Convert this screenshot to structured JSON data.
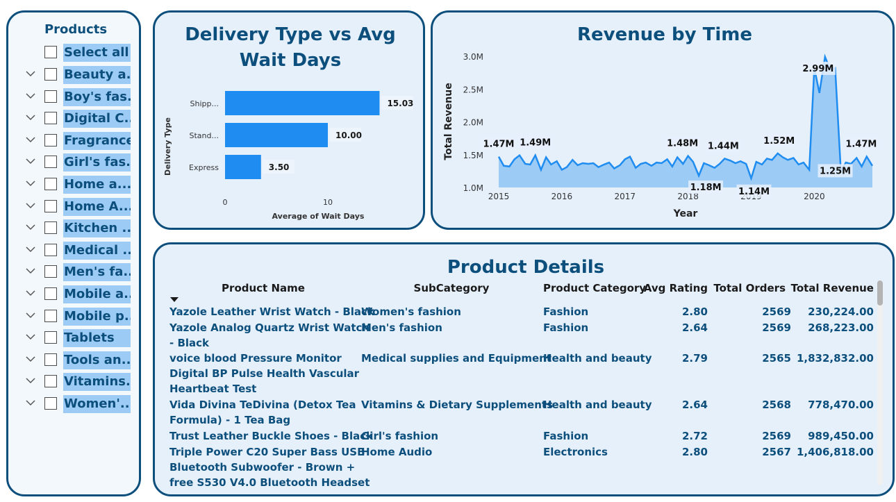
{
  "slicer": {
    "title": "Products",
    "select_all": "Select all",
    "items": [
      "Beauty a...",
      "Boy's fas...",
      "Digital C...",
      "Fragrances",
      "Girl's fas...",
      "Home a...",
      "Home A...",
      "Kitchen ...",
      "Medical ...",
      "Men's fa...",
      "Mobile a...",
      "Mobile p...",
      "Tablets",
      "Tools an...",
      "Vitamins...",
      "Women'..."
    ]
  },
  "bar_chart": {
    "title": "Delivery Type vs Avg Wait Days",
    "bar_color": "#1e8cf0"
  },
  "line_chart": {
    "title": "Revenue by Time",
    "line_color": "#1e8cf0",
    "area_color": "#9ccbf5"
  },
  "chart_data": [
    {
      "type": "bar",
      "orientation": "horizontal",
      "title": "Delivery Type vs Avg Wait Days",
      "xlabel": "Average of Wait Days",
      "ylabel": "Delivery Type",
      "categories": [
        "Shipp...",
        "Stand...",
        "Express"
      ],
      "values": [
        15.03,
        10.0,
        3.5
      ],
      "data_labels": [
        "15.03",
        "10.00",
        "3.50"
      ],
      "x_ticks": [
        "0",
        "10"
      ],
      "xlim": [
        0,
        20
      ]
    },
    {
      "type": "area",
      "title": "Revenue by Time",
      "xlabel": "Year",
      "ylabel": "Total Revenue",
      "x_ticks": [
        "2015",
        "2016",
        "2017",
        "2018",
        "2019",
        "2020"
      ],
      "y_ticks": [
        "1.0M",
        "1.5M",
        "2.0M",
        "2.5M",
        "3.0M"
      ],
      "ylim": [
        1.0,
        3.0
      ],
      "xlim": [
        2015.0,
        2020.92
      ],
      "x": [
        2015.0,
        2015.08,
        2015.17,
        2015.25,
        2015.33,
        2015.42,
        2015.5,
        2015.58,
        2015.67,
        2015.75,
        2015.83,
        2015.92,
        2016.0,
        2016.08,
        2016.17,
        2016.25,
        2016.33,
        2016.42,
        2016.5,
        2016.58,
        2016.67,
        2016.75,
        2016.83,
        2016.92,
        2017.0,
        2017.08,
        2017.17,
        2017.25,
        2017.33,
        2017.42,
        2017.5,
        2017.58,
        2017.67,
        2017.75,
        2017.83,
        2017.92,
        2018.0,
        2018.08,
        2018.17,
        2018.25,
        2018.33,
        2018.42,
        2018.5,
        2018.58,
        2018.67,
        2018.75,
        2018.83,
        2018.92,
        2019.0,
        2019.08,
        2019.17,
        2019.25,
        2019.33,
        2019.42,
        2019.5,
        2019.58,
        2019.67,
        2019.75,
        2019.83,
        2019.92,
        2020.0,
        2020.08,
        2020.17,
        2020.25,
        2020.33,
        2020.42,
        2020.5,
        2020.58,
        2020.67,
        2020.75,
        2020.83,
        2020.92
      ],
      "y": [
        1.47,
        1.33,
        1.32,
        1.43,
        1.49,
        1.36,
        1.35,
        1.49,
        1.27,
        1.46,
        1.35,
        1.4,
        1.27,
        1.31,
        1.42,
        1.34,
        1.37,
        1.36,
        1.37,
        1.31,
        1.35,
        1.38,
        1.29,
        1.34,
        1.43,
        1.47,
        1.3,
        1.36,
        1.38,
        1.33,
        1.38,
        1.37,
        1.43,
        1.32,
        1.46,
        1.36,
        1.48,
        1.39,
        1.18,
        1.37,
        1.34,
        1.3,
        1.36,
        1.44,
        1.41,
        1.37,
        1.4,
        1.36,
        1.14,
        1.39,
        1.35,
        1.44,
        1.42,
        1.52,
        1.46,
        1.42,
        1.45,
        1.35,
        1.38,
        1.27,
        2.82,
        2.44,
        2.99,
        2.8,
        2.82,
        1.25,
        1.38,
        1.36,
        1.45,
        1.32,
        1.47,
        1.33
      ],
      "data_labels": [
        {
          "x": 2015.0,
          "y": 1.47,
          "text": "1.47M"
        },
        {
          "x": 2015.58,
          "y": 1.49,
          "text": "1.49M"
        },
        {
          "x": 2018.0,
          "y": 1.48,
          "text": "1.48M"
        },
        {
          "x": 2018.17,
          "y": 1.18,
          "text": "1.18M"
        },
        {
          "x": 2018.58,
          "y": 1.44,
          "text": "1.44M"
        },
        {
          "x": 2019.0,
          "y": 1.14,
          "text": "1.14M"
        },
        {
          "x": 2019.42,
          "y": 1.52,
          "text": "1.52M"
        },
        {
          "x": 2020.17,
          "y": 2.99,
          "text": "2.99M"
        },
        {
          "x": 2020.42,
          "y": 1.25,
          "text": "1.25M"
        },
        {
          "x": 2020.83,
          "y": 1.47,
          "text": "1.47M"
        }
      ]
    }
  ],
  "table": {
    "title": "Product Details",
    "headers": [
      "Product Name",
      "SubCategory",
      "Product Category",
      "Avg Rating",
      "Total Orders",
      "Total Revenue"
    ],
    "rows": [
      {
        "name": [
          "Yazole Leather Wrist Watch - Black"
        ],
        "sub": "Women's fashion",
        "cat": "Fashion",
        "rating": "2.80",
        "orders": "2569",
        "revenue": "230,224.00"
      },
      {
        "name": [
          "Yazole Analog Quartz Wrist Watch",
          "- Black"
        ],
        "sub": "Men's fashion",
        "cat": "Fashion",
        "rating": "2.64",
        "orders": "2569",
        "revenue": "268,223.00"
      },
      {
        "name": [
          "voice blood Pressure Monitor",
          "Digital BP Pulse Health Vascular",
          "Heartbeat Test"
        ],
        "sub": "Medical supplies and Equipment",
        "cat": "Health and beauty",
        "rating": "2.79",
        "orders": "2565",
        "revenue": "1,832,832.00"
      },
      {
        "name": [
          "Vida Divina TeDivina (Detox Tea",
          "Formula) - 1 Tea Bag"
        ],
        "sub": "Vitamins & Dietary Supplements",
        "cat": "Health and beauty",
        "rating": "2.64",
        "orders": "2568",
        "revenue": "778,470.00"
      },
      {
        "name": [
          "Trust Leather Buckle Shoes - Black"
        ],
        "sub": "Girl's fashion",
        "cat": "Fashion",
        "rating": "2.72",
        "orders": "2569",
        "revenue": "989,450.00"
      },
      {
        "name": [
          "Triple Power C20 Super Bass USB",
          "Bluetooth Subwoofer - Brown +",
          "free S530 V4.0 Bluetooth Headset"
        ],
        "sub": "Home Audio",
        "cat": "Electronics",
        "rating": "2.80",
        "orders": "2567",
        "revenue": "1,406,818.00"
      }
    ]
  }
}
